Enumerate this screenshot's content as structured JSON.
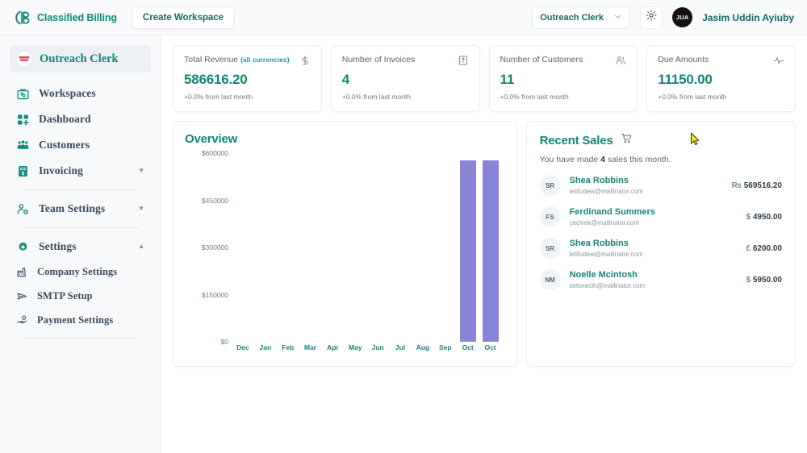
{
  "header": {
    "brand_name": "Classified Billing",
    "brand_logo_icon": "cb-monogram-icon",
    "create_workspace_label": "Create Workspace",
    "workspace_select_value": "Outreach Clerk",
    "workspace_select_icon": "chevron-down-icon",
    "theme_toggle_icon": "sun-icon",
    "avatar_initials": "JUA",
    "user_name": "Jasim Uddin Ayiuby"
  },
  "sidebar": {
    "active_workspace": "Outreach Clerk",
    "items": [
      {
        "label": "Workspaces",
        "icon": "briefcase-icon",
        "expandable": false
      },
      {
        "label": "Dashboard",
        "icon": "grid-plus-icon",
        "expandable": false
      },
      {
        "label": "Customers",
        "icon": "users-icon",
        "expandable": false
      },
      {
        "label": "Invoicing",
        "icon": "invoice-icon",
        "expandable": true,
        "caret": "▼"
      },
      {
        "label": "Team Settings",
        "icon": "user-gear-icon",
        "expandable": true,
        "caret": "▼"
      },
      {
        "label": "Settings",
        "icon": "gear-icon",
        "expandable": true,
        "caret": "▲"
      }
    ],
    "sub_items": [
      {
        "label": "Company Settings",
        "icon": "factory-icon"
      },
      {
        "label": "SMTP Setup",
        "icon": "send-icon"
      },
      {
        "label": "Payment Settings",
        "icon": "hand-coin-icon"
      }
    ]
  },
  "stats": [
    {
      "title": "Total Revenue",
      "title_suffix": "(all currencies)",
      "icon": "dollar-icon",
      "value": "586616.20",
      "change": "+0.0% from last month"
    },
    {
      "title": "Number of Invoices",
      "title_suffix": "",
      "icon": "receipt-icon",
      "value": "4",
      "change": "+0.0% from last month"
    },
    {
      "title": "Number of Customers",
      "title_suffix": "",
      "icon": "people-icon",
      "value": "11",
      "change": "+0.0% from last month"
    },
    {
      "title": "Due Amounts",
      "title_suffix": "",
      "icon": "activity-icon",
      "value": "11150.00",
      "change": "+0.0% from last month"
    }
  ],
  "overview": {
    "title": "Overview"
  },
  "chart_data": {
    "type": "bar",
    "title": "Overview",
    "categories": [
      "Dec",
      "Jan",
      "Feb",
      "Mar",
      "Apr",
      "May",
      "Jun",
      "Jul",
      "Aug",
      "Sep",
      "Oct",
      "Oct"
    ],
    "values": [
      0,
      0,
      0,
      0,
      0,
      0,
      0,
      0,
      0,
      0,
      576000,
      576000
    ],
    "xlabel": "",
    "ylabel": "",
    "ylim": [
      0,
      600000
    ],
    "ytick_labels": [
      "$600000",
      "$450000",
      "$300000",
      "$150000",
      "$0"
    ],
    "ytick_values": [
      600000,
      450000,
      300000,
      150000,
      0
    ],
    "grid": false,
    "legend": "none",
    "bar_color": "#8884d8"
  },
  "recent_sales": {
    "title": "Recent Sales",
    "title_icon": "cart-icon",
    "subtitle_prefix": "You have made ",
    "subtitle_count": "4",
    "subtitle_suffix": " sales this month.",
    "rows": [
      {
        "initials": "SR",
        "name": "Shea Robbins",
        "email": "letifudew@mailinator.com",
        "currency": "₨",
        "amount": "569516.20"
      },
      {
        "initials": "FS",
        "name": "Ferdinand Summers",
        "email": "cecivek@mailinator.com",
        "currency": "$",
        "amount": "4950.00"
      },
      {
        "initials": "SR",
        "name": "Shea Robbins",
        "email": "letifudew@mailinator.com",
        "currency": "£",
        "amount": "6200.00"
      },
      {
        "initials": "NM",
        "name": "Noelle Mcintosh",
        "email": "setoxecih@mailinator.com",
        "currency": "$",
        "amount": "5950.00"
      }
    ]
  },
  "colors": {
    "accent_teal": "#14857a",
    "bar_purple": "#8884d8",
    "sidebar_bg": "#f7f9fb",
    "header_bg": "#f8fafc"
  }
}
